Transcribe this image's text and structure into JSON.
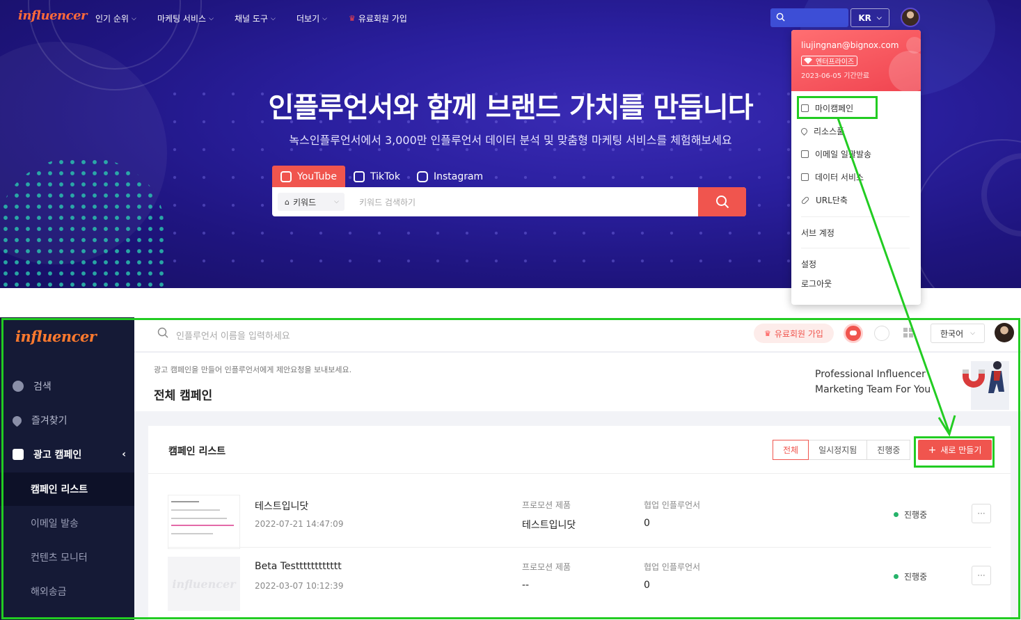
{
  "top": {
    "logo": "influencer",
    "nav": [
      {
        "label": "인기 순위"
      },
      {
        "label": "마케팅 서비스"
      },
      {
        "label": "채널 도구"
      },
      {
        "label": "더보기"
      }
    ],
    "premium_label": "유료회원 가입",
    "lang": "KR",
    "hero_title": "인플루언서와 함께 브랜드 가치를 만듭니다",
    "hero_subtitle": "녹스인플루언서에서 3,000만 인플루언서 데이터 분석 및 맞춤형 마케팅 서비스를 체험해보세요",
    "platform_tabs": [
      "YouTube",
      "TikTok",
      "Instagram"
    ],
    "keyword_select": "키워드",
    "search_placeholder": "키워드 검색하기"
  },
  "dropdown": {
    "email": "liujingnan@bignox.com",
    "plan": "엔터프라이즈",
    "expire": "2023-06-05 기간만료",
    "items": [
      {
        "label": "마이캠페인",
        "icon": "document-icon"
      },
      {
        "label": "리소스풀",
        "icon": "heart-icon"
      },
      {
        "label": "이메일 일괄발송",
        "icon": "mail-icon"
      },
      {
        "label": "데이터 서비스",
        "icon": "data-icon"
      },
      {
        "label": "URL단축",
        "icon": "link-icon"
      }
    ],
    "sub_account": "서브 계정",
    "settings": "설정",
    "logout": "로그아웃"
  },
  "app": {
    "logo": "influencer",
    "sidebar": {
      "items": [
        {
          "label": "검색"
        },
        {
          "label": "즐겨찾기"
        },
        {
          "label": "광고 캠페인"
        }
      ],
      "sub_items": [
        {
          "label": "캠페인 리스트"
        },
        {
          "label": "이메일 발송"
        },
        {
          "label": "컨텐츠 모니터"
        },
        {
          "label": "해외송금"
        }
      ]
    },
    "search_placeholder": "인플루언서 이름을 입력하세요",
    "premium_label": "유료회원 가입",
    "language": "한국어",
    "banner": {
      "hint": "광고 캠페인을 만들어 인플루언서에게 제안요청을 보내보세요.",
      "title": "전체 캠페인",
      "promo_line1": "Professional Influencer",
      "promo_line2": "Marketing Team For You"
    },
    "campaigns": {
      "title": "캠페인 리스트",
      "filters": [
        "전체",
        "일시정지됨",
        "진행중"
      ],
      "new_button": "새로 만들기",
      "col_product": "프로모션 제품",
      "col_influencer": "협업 인플루언서",
      "rows": [
        {
          "name": "테스트입니닷",
          "date": "2022-07-21 14:47:09",
          "product": "테스트입니닷",
          "influencers": "0",
          "status": "진행중",
          "more": "···"
        },
        {
          "name": "Beta Testttttttttttt",
          "date": "2022-03-07 10:12:39",
          "product": "--",
          "influencers": "0",
          "status": "진행중",
          "more": "···"
        }
      ]
    }
  },
  "colors": {
    "accent": "#f0554e",
    "sidebar_bg": "#151a36",
    "hero_bg": "#2a1f9e",
    "highlight": "#22cc22",
    "status_green": "#26b36a"
  }
}
